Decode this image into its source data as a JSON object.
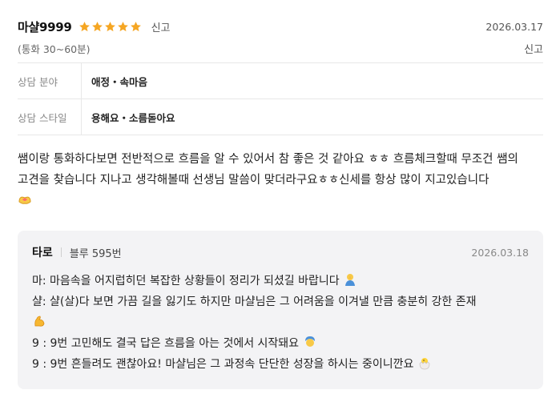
{
  "review": {
    "nickname": "마샬9999",
    "rating": 5,
    "report_label": "신고",
    "date": "2026.03.17",
    "call_info": "(통화 30~60분)",
    "report_label_2": "신고",
    "info": [
      {
        "label": "상담 분야",
        "value": "애정・속마음"
      },
      {
        "label": "상담 스타일",
        "value": "용해요・소름돋아요"
      }
    ],
    "body_text": "쌤이랑 통화하다보면 전반적으로 흐름을 알 수 있어서 참 좋은 것 같아요 ㅎㅎ 흐름체크할때 무조건 쌤의 고견을 찾습니다 지나고 생각해볼때 선생님 말씀이 맞더라구요ㅎㅎ신세를 항상 많이 지고있습니다",
    "body_emoji": "heart-hands-emoji"
  },
  "reply": {
    "name": "타로",
    "meta": "블루 595번",
    "date": "2026.03.18",
    "lines": [
      {
        "text": "마: 마음속을 어지럽히던 복잡한 상황들이 정리가 되셨길 바랍니다",
        "emoji": "praying-person-emoji"
      },
      {
        "text": "샬: 샬(살)다 보면 가끔 길을 잃기도 하지만 마샬님은 그 어려움을 이겨낼 만큼 충분히 강한 존재",
        "emoji": "flexed-biceps-emoji"
      },
      {
        "text": "9 : 9번 고민해도 결국 답은 흐름을 아는 것에서 시작돼요",
        "emoji": "person-gesturing-ok-emoji"
      },
      {
        "text": "9 : 9번 흔들려도 괜찮아요! 마샬님은 그 과정속 단단한 성장을 하시는 중이니깐요",
        "emoji": "hatching-chick-emoji"
      }
    ]
  },
  "colors": {
    "star": "#f5a623",
    "reply_bg": "#f3f3f5",
    "divider": "#e8e8e8"
  }
}
